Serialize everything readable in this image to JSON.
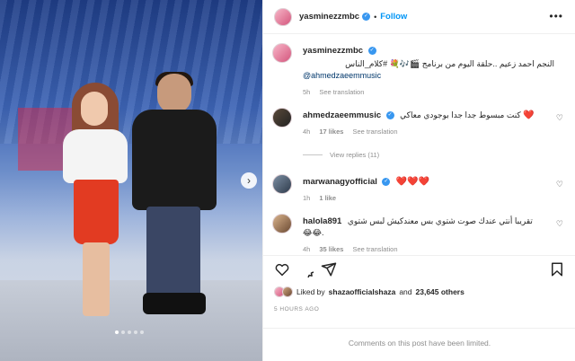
{
  "header": {
    "username": "yasminezzmbc",
    "separator": "•",
    "follow_label": "Follow",
    "more_icon": "more-horizontal-icon"
  },
  "caption": {
    "username": "yasminezzmbc",
    "text": "النجم احمد زعيم ..حلقة اليوم من برنامج 🎬🎶💐 #كلام_الناس",
    "mention": "@ahmedzaeemmusic",
    "time": "5h",
    "see_translation": "See translation"
  },
  "comments": [
    {
      "username": "ahmedzaeemmusic",
      "verified": true,
      "text": "كنت مبسوط جدا جدا بوجودي معاكي",
      "emoji": "❤️",
      "time": "4h",
      "likes": "17 likes",
      "see_translation": "See translation"
    },
    {
      "username": "marwanagyofficial",
      "verified": true,
      "text": "",
      "emoji": "❤️❤️❤️",
      "time": "1h",
      "likes": "1 like",
      "see_translation": ""
    },
    {
      "username": "halola891",
      "verified": false,
      "text": "تقريبا أنتي عندك صوت شتوي بس معندكيش لبس شتوي",
      "emoji": "😂😂.",
      "time": "4h",
      "likes": "35 likes",
      "see_translation": "See translation"
    }
  ],
  "view_replies": "View replies (11)",
  "actions": {
    "liked_prefix": "Liked by",
    "liked_user": "shazaofficialshaza",
    "liked_and": "and",
    "liked_count": "23,645 others",
    "time_ago": "5 HOURS AGO",
    "comments_limited": "Comments on this post have been limited."
  },
  "carousel": {
    "dot_count": 5,
    "active_index": 0,
    "next_icon": "chevron-right-icon"
  }
}
